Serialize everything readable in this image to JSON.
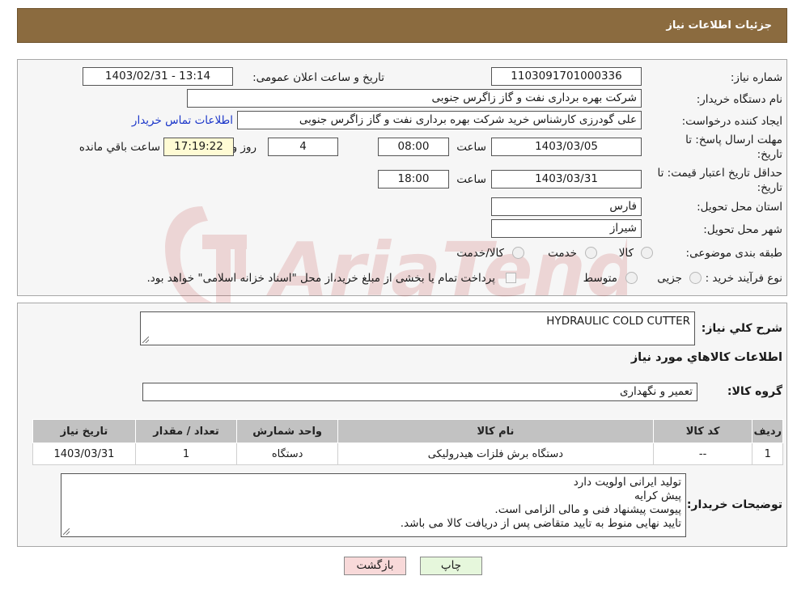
{
  "header": {
    "title": "جزئیات اطلاعات نیاز"
  },
  "form": {
    "need_number_label": "شماره نیاز:",
    "need_number": "1103091701000336",
    "announce_label": "تاریخ و ساعت اعلان عمومی:",
    "announce_value": "1403/02/31 - 13:14",
    "buyer_org_label": "نام دستگاه خریدار:",
    "buyer_org": "شرکت بهره برداری نفت و گاز زاگرس جنوبی",
    "requester_label": "ایجاد کننده درخواست:",
    "requester": "علی گودرزی کارشناس خرید شرکت بهره برداری نفت و گاز زاگرس جنوبی",
    "contact_link": "اطلاعات تماس خریدار",
    "reply_deadline_label_1": "مهلت ارسال پاسخ: تا",
    "reply_deadline_label_2": "تاریخ:",
    "reply_date": "1403/03/05",
    "hour_label": "ساعت",
    "reply_hour": "08:00",
    "days_value": "4",
    "days_label": "روز و",
    "remaining_time": "17:19:22",
    "remaining_label": "ساعت باقي مانده",
    "validity_label_1": "حداقل تاریخ اعتبار قیمت: تا",
    "validity_label_2": "تاریخ:",
    "validity_date": "1403/03/31",
    "validity_hour": "18:00",
    "province_label": "استان محل تحویل:",
    "province": "فارس",
    "city_label": "شهر محل تحویل:",
    "city": "شیراز",
    "category_label": "طبقه بندی موضوعی:",
    "category_options": [
      "کالا",
      "خدمت",
      "کالا/خدمت"
    ],
    "process_label": "نوع فرآیند خرید :",
    "process_options": [
      "جزیی",
      "متوسط"
    ],
    "payment_note": "پرداخت تمام یا بخشی از مبلغ خرید،از محل \"اسناد خزانه اسلامی\" خواهد بود."
  },
  "details": {
    "general_desc_label": "شرح کلي نیاز:",
    "general_desc": "HYDRAULIC COLD CUTTER",
    "goods_info_title": "اطلاعات کالاهاي مورد نیاز",
    "goods_group_label": "گروه کالا:",
    "goods_group": "تعمیر و نگهداری",
    "table": {
      "headers": [
        "ردیف",
        "کد کالا",
        "نام کالا",
        "واحد شمارش",
        "تعداد / مقدار",
        "تاریخ نیاز"
      ],
      "rows": [
        [
          "1",
          "--",
          "دستگاه برش فلزات هیدرولیکی",
          "دستگاه",
          "1",
          "1403/03/31"
        ]
      ]
    },
    "buyer_notes_label": "توضیحات خریدار:",
    "buyer_notes": [
      "تولید ایرانی اولویت دارد",
      "پیش کرایه",
      "پیوست پیشنهاد فنی و مالی الزامی است.",
      "تایید نهایی منوط به تایید متقاضی پس از دریافت کالا می باشد."
    ]
  },
  "buttons": {
    "print": "چاپ",
    "back": "بازگشت"
  },
  "watermark": {
    "text": "AriaTender.neT"
  },
  "colors": {
    "header_bg": "#8b6b3f",
    "back_button_bg": "#f8d9d9",
    "print_button_bg": "#e6f7dc"
  }
}
